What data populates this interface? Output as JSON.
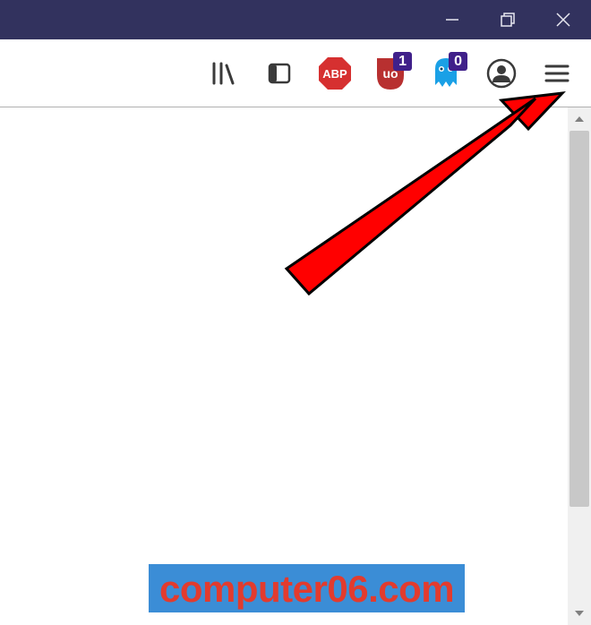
{
  "window": {
    "minimize": "–",
    "restore": "❐",
    "close": "✕"
  },
  "toolbar": {
    "library_tooltip": "Library",
    "sidebars_tooltip": "Sidebars",
    "abp_label": "ABP",
    "ublock_badge": "1",
    "ghostery_badge": "0",
    "profile_tooltip": "Profile",
    "menu_tooltip": "Open menu"
  },
  "watermark": {
    "text": "computer06.com"
  },
  "colors": {
    "titlebar": "#32325e",
    "abp_red": "#d63030",
    "ublock_red": "#b83030",
    "ghostery_blue": "#1aa0e6",
    "badge_purple": "#40208a",
    "arrow_red": "#e60000",
    "watermark_bg": "#3b8dd6",
    "watermark_text": "#e23b2e"
  }
}
